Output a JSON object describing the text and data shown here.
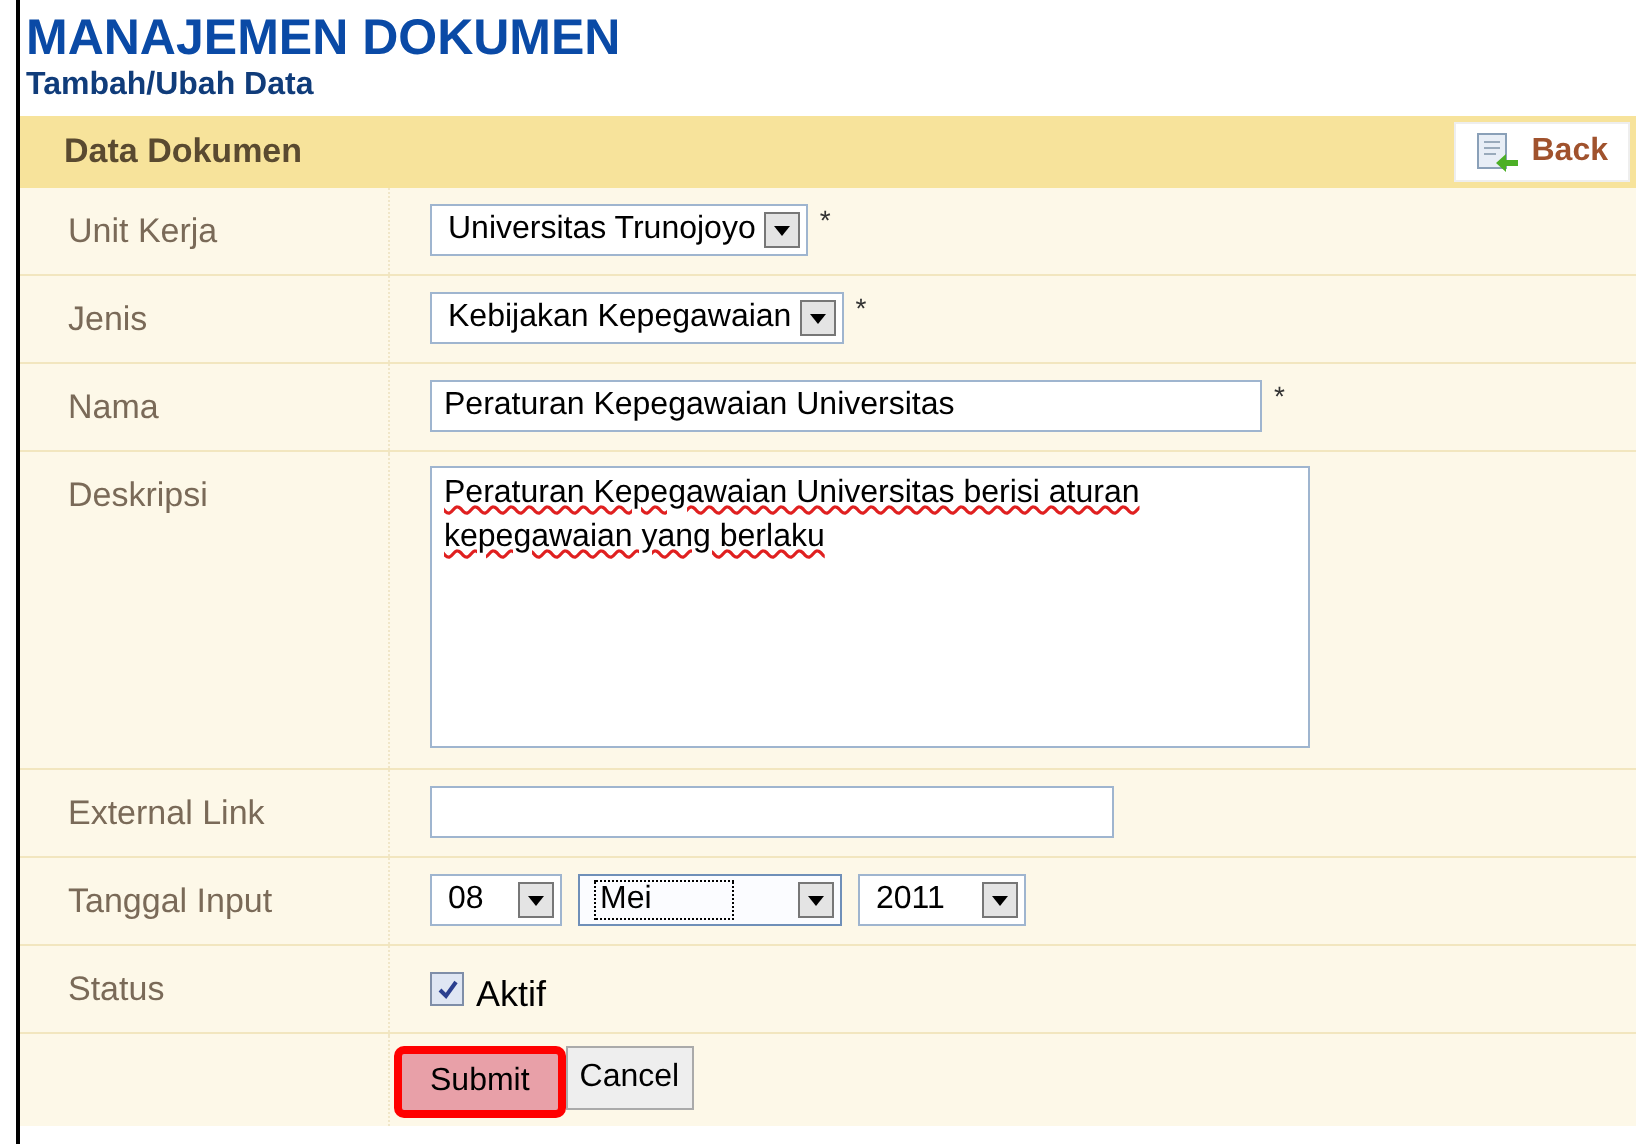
{
  "title": "MANAJEMEN DOKUMEN",
  "subtitle": "Tambah/Ubah Data",
  "panel": {
    "title": "Data Dokumen",
    "back_button": "Back"
  },
  "fields": [
    {
      "label": "Unit Kerja",
      "kind": "select",
      "value": "Universitas Trunojoyo",
      "required_mark": "*"
    },
    {
      "label": "Jenis",
      "kind": "select",
      "value": "Kebijakan Kepegawaian",
      "required_mark": "*"
    },
    {
      "label": "Nama",
      "kind": "text",
      "value": "Peraturan Kepegawaian Universitas",
      "required_mark": "*"
    },
    {
      "label": "Deskripsi",
      "kind": "textarea",
      "value": "Peraturan Kepegawaian Universitas berisi aturan kepegawaian yang berlaku"
    },
    {
      "label": "External Link",
      "kind": "text"
    },
    {
      "label": "Tanggal Input",
      "kind": "date",
      "parts": [
        {
          "value": "08",
          "focused": false
        },
        {
          "value": "Mei",
          "focused": true
        },
        {
          "value": "2011",
          "focused": false
        }
      ]
    },
    {
      "label": "Status",
      "kind": "checkbox",
      "option": "Aktif",
      "checked": true
    }
  ],
  "buttons": [
    {
      "label": "Submit",
      "highlighted": true
    },
    {
      "label": "Cancel",
      "highlighted": false
    }
  ]
}
